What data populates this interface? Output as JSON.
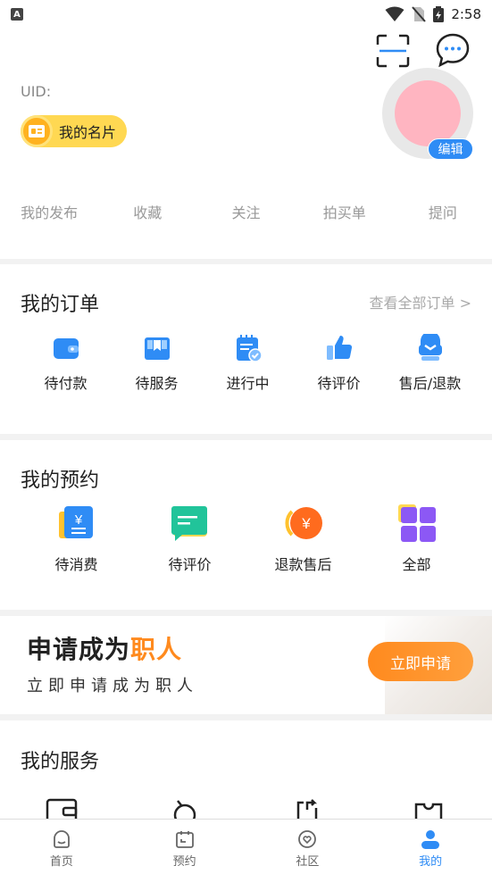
{
  "status_bar": {
    "time": "2:58",
    "left_badge": "A"
  },
  "header": {
    "uid_label": "UID:",
    "card_button_label": "我的名片",
    "edit_label": "编辑",
    "tabs": [
      "我的发布",
      "收藏",
      "关注",
      "拍买单",
      "提问"
    ]
  },
  "orders": {
    "title": "我的订单",
    "see_all": "查看全部订单 >",
    "items": [
      {
        "label": "待付款",
        "icon": "wallet-icon"
      },
      {
        "label": "待服务",
        "icon": "gift-box-icon"
      },
      {
        "label": "进行中",
        "icon": "notepad-check-icon"
      },
      {
        "label": "待评价",
        "icon": "thumbs-up-icon"
      },
      {
        "label": "售后/退款",
        "icon": "service-refund-icon"
      }
    ]
  },
  "appointments": {
    "title": "我的预约",
    "items": [
      {
        "label": "待消费",
        "icon": "yen-bill-icon"
      },
      {
        "label": "待评价",
        "icon": "chat-review-icon"
      },
      {
        "label": "退款售后",
        "icon": "yen-coin-refund-icon"
      },
      {
        "label": "全部",
        "icon": "grid-all-icon"
      }
    ]
  },
  "banner": {
    "title_main": "申请成为",
    "title_highlight": "职人",
    "subtitle": "立即申请成为职人",
    "button": "立即申请"
  },
  "services": {
    "title": "我的服务",
    "icons": [
      "wallet-outline-icon",
      "search-outline-icon",
      "share-doc-icon",
      "ticket-icon"
    ]
  },
  "bottom_nav": [
    {
      "label": "首页",
      "icon": "home-icon"
    },
    {
      "label": "预约",
      "icon": "calendar-icon"
    },
    {
      "label": "社区",
      "icon": "community-icon"
    },
    {
      "label": "我的",
      "icon": "profile-icon",
      "active": true
    }
  ],
  "colors": {
    "accent": "#2f8cf5",
    "orange": "#ff8a1e",
    "yellow": "#ffd852"
  }
}
